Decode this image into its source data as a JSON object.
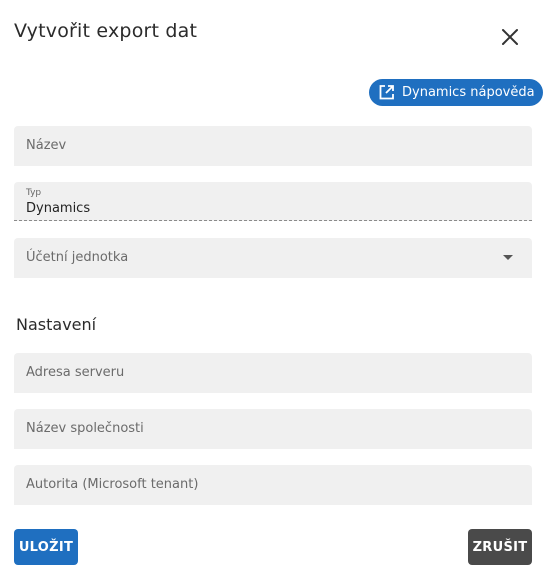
{
  "dialog": {
    "title": "Vytvořit export dat",
    "help_button": "Dynamics nápověda",
    "fields": {
      "name_placeholder": "Název",
      "type_label": "Typ",
      "type_value": "Dynamics",
      "unit_placeholder": "Účetní jednotka"
    },
    "settings": {
      "heading": "Nastavení",
      "server_placeholder": "Adresa serveru",
      "company_placeholder": "Název společnosti",
      "authority_placeholder": "Autorita (Microsoft tenant)"
    },
    "actions": {
      "save": "ULOŽIT",
      "cancel": "ZRUŠIT"
    }
  },
  "colors": {
    "primary": "#1f6fc0",
    "cancel": "#4a4a4a",
    "field_bg": "#f0f0f0"
  }
}
